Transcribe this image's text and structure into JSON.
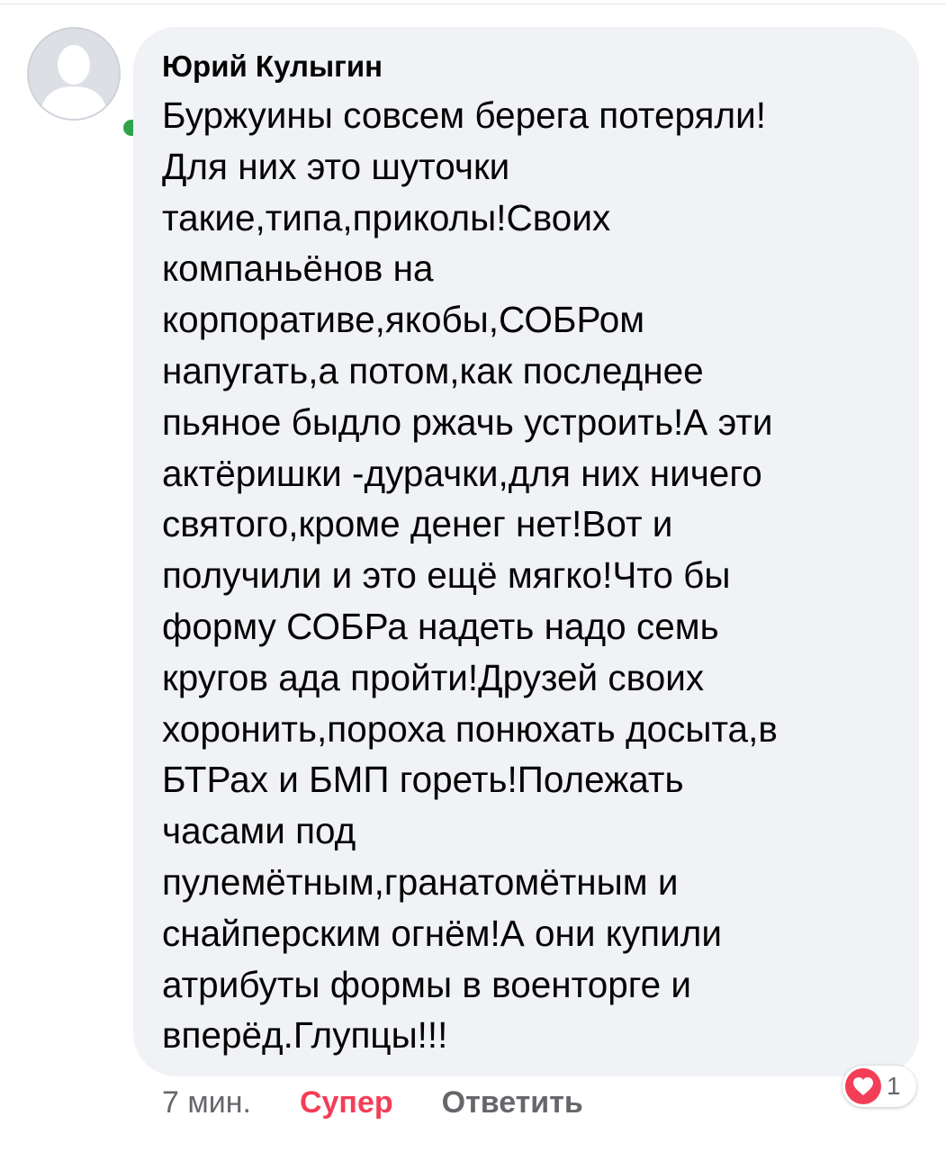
{
  "comment": {
    "author": "Юрий Кулыгин",
    "text": "Буржуины совсем берега потеряли!\nДля них это шуточки\nтакие,типа,приколы!Своих\nкомпаньёнов на\nкорпоративе,якобы,СОБРом\nнапугать,а потом,как последнее\nпьяное быдло ржачь устроить!А эти\nактёришки -дурачки,для них ничего\nсвятого,кроме денег нет!Вот и\nполучили и это ещё мягко!Что бы\nформу СОБРа надеть надо семь\nкругов ада пройти!Друзей своих\nхоронить,пороха понюхать досыта,в\nБТРах и БМП гореть!Полежать\nчасами под\nпулемётным,гранатомётным и\nснайперским огнём!А они купили\nатрибуты формы в военторге и\nвперёд.Глупцы!!!",
    "online": true
  },
  "actions": {
    "time": "7 мин.",
    "reaction_label": "Супер",
    "reply_label": "Ответить"
  },
  "reactions": {
    "icon": "heart-icon",
    "count": "1"
  },
  "colors": {
    "bubble": "#f0f2f5",
    "text": "#050505",
    "muted": "#65676b",
    "love": "#f33e58",
    "online": "#31a24c"
  }
}
